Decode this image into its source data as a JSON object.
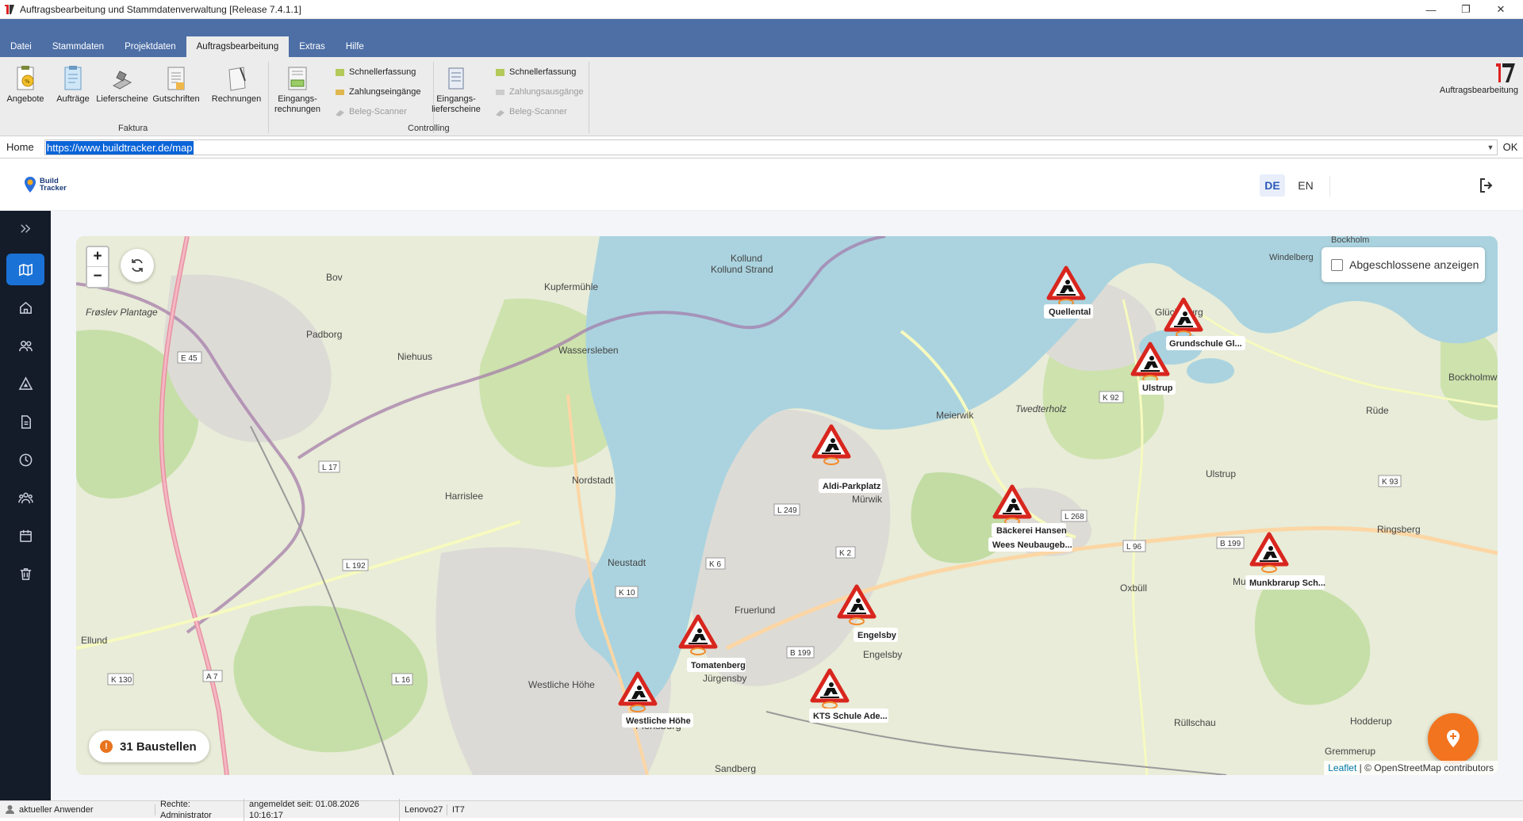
{
  "window": {
    "title": "Auftragsbearbeitung und Stammdatenverwaltung [Release 7.4.1.1]"
  },
  "menu": {
    "tabs": [
      "Datei",
      "Stammdaten",
      "Projektdaten",
      "Auftragsbearbeitung",
      "Extras",
      "Hilfe"
    ],
    "active_tab": "Auftragsbearbeitung"
  },
  "ribbon": {
    "faktura": {
      "label": "Faktura",
      "buttons": [
        "Angebote",
        "Aufträge",
        "Lieferscheine",
        "Gutschriften",
        "Rechnungen"
      ]
    },
    "eingangsrechnungen": "Eingangs-\nrechnungen",
    "eingangslieferscheine": "Eingangs-\nlieferscheine",
    "left_small": [
      "Schnellerfassung",
      "Zahlungseingänge",
      "Beleg-Scanner"
    ],
    "right_small": [
      "Schnellerfassung",
      "Zahlungsausgänge",
      "Beleg-Scanner"
    ],
    "controlling": {
      "label": "Controlling"
    },
    "right_label": "Auftragsbearbeitung"
  },
  "address": {
    "home": "Home",
    "url": "https://www.buildtracker.de/map",
    "ok": "OK"
  },
  "app": {
    "logo_line1": "Build",
    "logo_line2": "Tracker",
    "lang_de": "DE",
    "lang_en": "EN",
    "show_completed_label": "Abgeschlossene anzeigen",
    "count_label": "31 Baustellen",
    "attribution_leaflet": "Leaflet",
    "attribution_osm": " | © OpenStreetMap contributors"
  },
  "sites": [
    {
      "label": "Quellental"
    },
    {
      "label": "Grundschule Gl..."
    },
    {
      "label": "Ulstrup"
    },
    {
      "label": "Aldi-Parkplatz"
    },
    {
      "label": "Bäckerei Hansen"
    },
    {
      "label": "Wees Neubaugeb..."
    },
    {
      "label": "Munkbrarup Sch..."
    },
    {
      "label": "Engelsby"
    },
    {
      "label": "Tomatenberg"
    },
    {
      "label": "KTS Schule Ade..."
    },
    {
      "label": "Westliche Höhe"
    }
  ],
  "places": [
    "Kollund",
    "Kollund Strand",
    "Bov",
    "Kupfermühle",
    "Frøslev Plantage",
    "Padborg",
    "Niehuus",
    "Wassersleben",
    "Harrislee",
    "Nordstadt",
    "Neustadt",
    "Fruerlund",
    "Jürgensby",
    "Westliche Höhe",
    "Flensburg",
    "Sandberg",
    "Mürwik",
    "Meierwik",
    "Twedterholz",
    "Glücksburg",
    "Oxbüll",
    "Ulstrup",
    "Ringsberg",
    "Rüde",
    "Bockholmwik",
    "Munkbrarup",
    "Engelsby",
    "Rüllschau",
    "Hodderup",
    "Gremmerup",
    "Ellund",
    "Windelberg",
    "Bockholm"
  ],
  "roads": [
    "E 45",
    "L 17",
    "L 192",
    "L 16",
    "K 10",
    "K 6",
    "L 249",
    "K 2",
    "B 199",
    "K 92",
    "L 268",
    "B 199",
    "L 96",
    "K 93",
    "K 130",
    "A 7"
  ],
  "statusbar": {
    "user": "aktueller Anwender",
    "rights": "Rechte: Administrator",
    "since": "angemeldet seit: 01.08.2026 10:16:17",
    "machine": "Lenovo27",
    "it": "IT7"
  },
  "colors": {
    "menubar": "#4d6fa6",
    "sidebar": "#141b29",
    "active": "#1a72d6",
    "fab": "#f2741f",
    "water": "#aad3df",
    "warning": "#d8261e"
  }
}
